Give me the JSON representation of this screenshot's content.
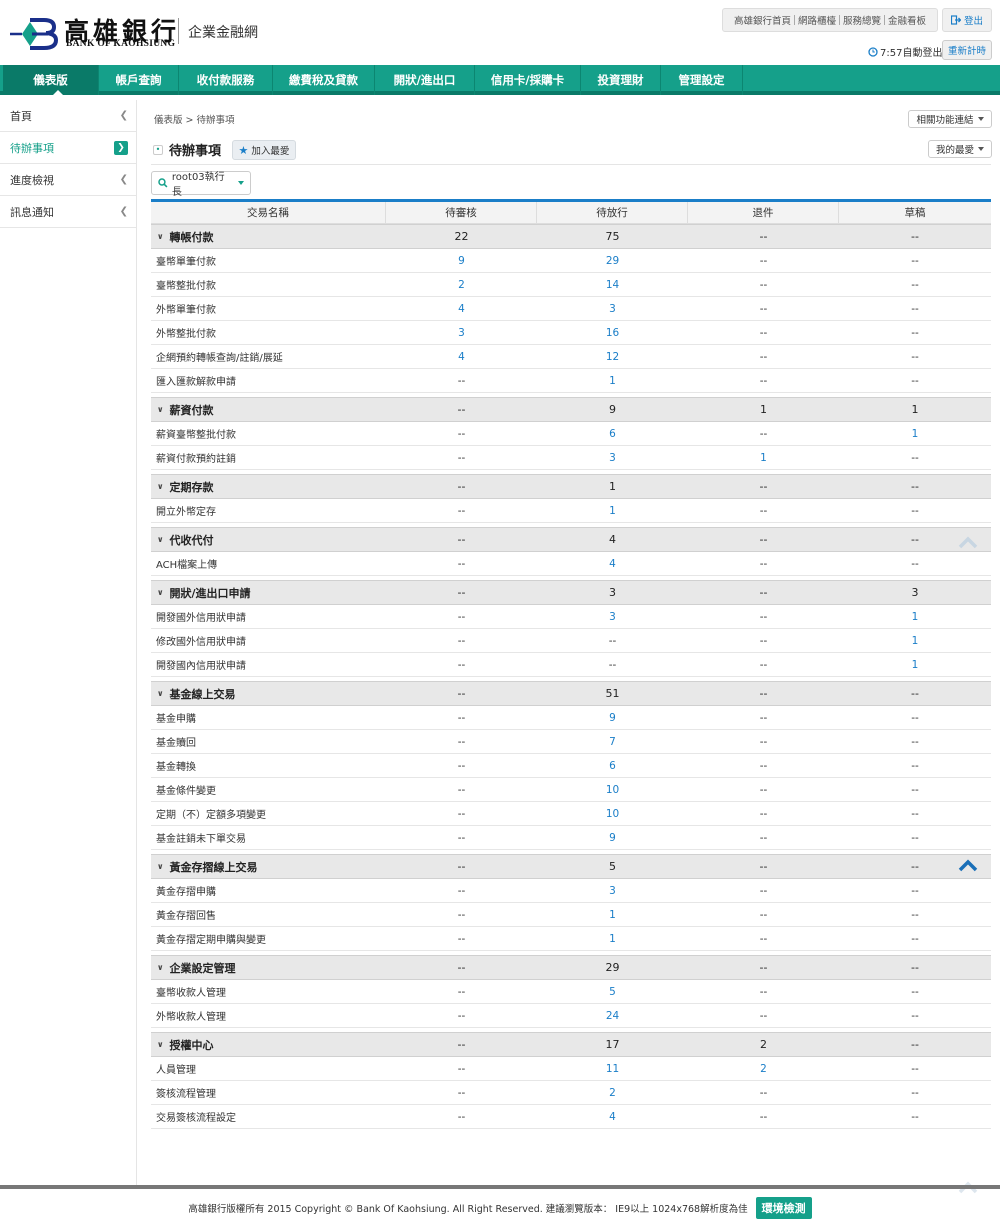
{
  "brand": {
    "name_cn": "高雄銀行",
    "name_en": "BANK OF KAOHSIUNG",
    "subtitle": "企業金融網",
    "logo_icon": "bank-logo-icon",
    "colors": {
      "primary": "#15a08a",
      "primary_dark": "#0a7a68",
      "link": "#1a7ec8",
      "logo_blue": "#1a2f8a"
    }
  },
  "header": {
    "links": [
      "高雄銀行首頁",
      "網路櫃檯",
      "服務總覽",
      "金融看板"
    ],
    "logout_label": "登出",
    "timer_text": "7:57自動登出",
    "reset_label": "重新計時"
  },
  "nav": {
    "items": [
      "儀表版",
      "帳戶查詢",
      "收付款服務",
      "繳費稅及貸款",
      "開狀/進出口",
      "信用卡/採購卡",
      "投資理財",
      "管理設定"
    ],
    "active": 0
  },
  "sidebar": {
    "items": [
      "首頁",
      "待辦事項",
      "進度檢視",
      "訊息通知"
    ],
    "active": 1
  },
  "breadcrumb": "儀表版 > 待辦事項",
  "page_title": "待辦事項",
  "add_fav_label": "加入最愛",
  "related_label": "相關功能連結",
  "my_fav_label": "我的最愛",
  "org_select": {
    "value": "root03執行長"
  },
  "table": {
    "headers": [
      "交易名稱",
      "待審核",
      "待放行",
      "退件",
      "草稿"
    ],
    "groups": [
      {
        "name": "轉帳付款",
        "totals": [
          "22",
          "75",
          "--",
          "--"
        ],
        "rows": [
          {
            "name": "臺幣單筆付款",
            "v": [
              "9",
              "29",
              "--",
              "--"
            ]
          },
          {
            "name": "臺幣整批付款",
            "v": [
              "2",
              "14",
              "--",
              "--"
            ]
          },
          {
            "name": "外幣單筆付款",
            "v": [
              "4",
              "3",
              "--",
              "--"
            ]
          },
          {
            "name": "外幣整批付款",
            "v": [
              "3",
              "16",
              "--",
              "--"
            ]
          },
          {
            "name": "企網預約轉帳查詢/註銷/展延",
            "v": [
              "4",
              "12",
              "--",
              "--"
            ]
          },
          {
            "name": "匯入匯款解款申請",
            "v": [
              "--",
              "1",
              "--",
              "--"
            ]
          }
        ]
      },
      {
        "name": "薪資付款",
        "totals": [
          "--",
          "9",
          "1",
          "1"
        ],
        "rows": [
          {
            "name": "薪資臺幣整批付款",
            "v": [
              "--",
              "6",
              "--",
              "1"
            ]
          },
          {
            "name": "薪資付款預約註銷",
            "v": [
              "--",
              "3",
              "1",
              "--"
            ]
          }
        ]
      },
      {
        "name": "定期存款",
        "totals": [
          "--",
          "1",
          "--",
          "--"
        ],
        "rows": [
          {
            "name": "開立外幣定存",
            "v": [
              "--",
              "1",
              "--",
              "--"
            ]
          }
        ]
      },
      {
        "name": "代收代付",
        "totals": [
          "--",
          "4",
          "--",
          "--"
        ],
        "rows": [
          {
            "name": "ACH檔案上傳",
            "v": [
              "--",
              "4",
              "--",
              "--"
            ]
          }
        ]
      },
      {
        "name": "開狀/進出口申請",
        "totals": [
          "--",
          "3",
          "--",
          "3"
        ],
        "rows": [
          {
            "name": "開發國外信用狀申請",
            "v": [
              "--",
              "3",
              "--",
              "1"
            ]
          },
          {
            "name": "修改國外信用狀申請",
            "v": [
              "--",
              "--",
              "--",
              "1"
            ]
          },
          {
            "name": "開發國內信用狀申請",
            "v": [
              "--",
              "--",
              "--",
              "1"
            ]
          }
        ]
      },
      {
        "name": "基金線上交易",
        "totals": [
          "--",
          "51",
          "--",
          "--"
        ],
        "rows": [
          {
            "name": "基金申購",
            "v": [
              "--",
              "9",
              "--",
              "--"
            ]
          },
          {
            "name": "基金贖回",
            "v": [
              "--",
              "7",
              "--",
              "--"
            ]
          },
          {
            "name": "基金轉換",
            "v": [
              "--",
              "6",
              "--",
              "--"
            ]
          },
          {
            "name": "基金條件變更",
            "v": [
              "--",
              "10",
              "--",
              "--"
            ]
          },
          {
            "name": "定期（不）定額多項變更",
            "v": [
              "--",
              "10",
              "--",
              "--"
            ]
          },
          {
            "name": "基金註銷未下單交易",
            "v": [
              "--",
              "9",
              "--",
              "--"
            ]
          }
        ]
      },
      {
        "name": "黃金存摺線上交易",
        "totals": [
          "--",
          "5",
          "--",
          "--"
        ],
        "rows": [
          {
            "name": "黃金存摺申購",
            "v": [
              "--",
              "3",
              "--",
              "--"
            ]
          },
          {
            "name": "黃金存摺回售",
            "v": [
              "--",
              "1",
              "--",
              "--"
            ]
          },
          {
            "name": "黃金存摺定期申購與變更",
            "v": [
              "--",
              "1",
              "--",
              "--"
            ]
          }
        ]
      },
      {
        "name": "企業設定管理",
        "totals": [
          "--",
          "29",
          "--",
          "--"
        ],
        "rows": [
          {
            "name": "臺幣收款人管理",
            "v": [
              "--",
              "5",
              "--",
              "--"
            ]
          },
          {
            "name": "外幣收款人管理",
            "v": [
              "--",
              "24",
              "--",
              "--"
            ]
          }
        ]
      },
      {
        "name": "授權中心",
        "totals": [
          "--",
          "17",
          "2",
          "--"
        ],
        "rows": [
          {
            "name": "人員管理",
            "v": [
              "--",
              "11",
              "2",
              "--"
            ]
          },
          {
            "name": "簽核流程管理",
            "v": [
              "--",
              "2",
              "--",
              "--"
            ]
          },
          {
            "name": "交易簽核流程設定",
            "v": [
              "--",
              "4",
              "--",
              "--"
            ]
          }
        ]
      }
    ]
  },
  "footer": {
    "text": "高雄銀行版權所有 2015 Copyright © Bank Of Kaohsiung. All Right Reserved. 建議瀏覽版本： IE9以上 1024x768解析度為佳",
    "env_label": "環境檢測"
  }
}
